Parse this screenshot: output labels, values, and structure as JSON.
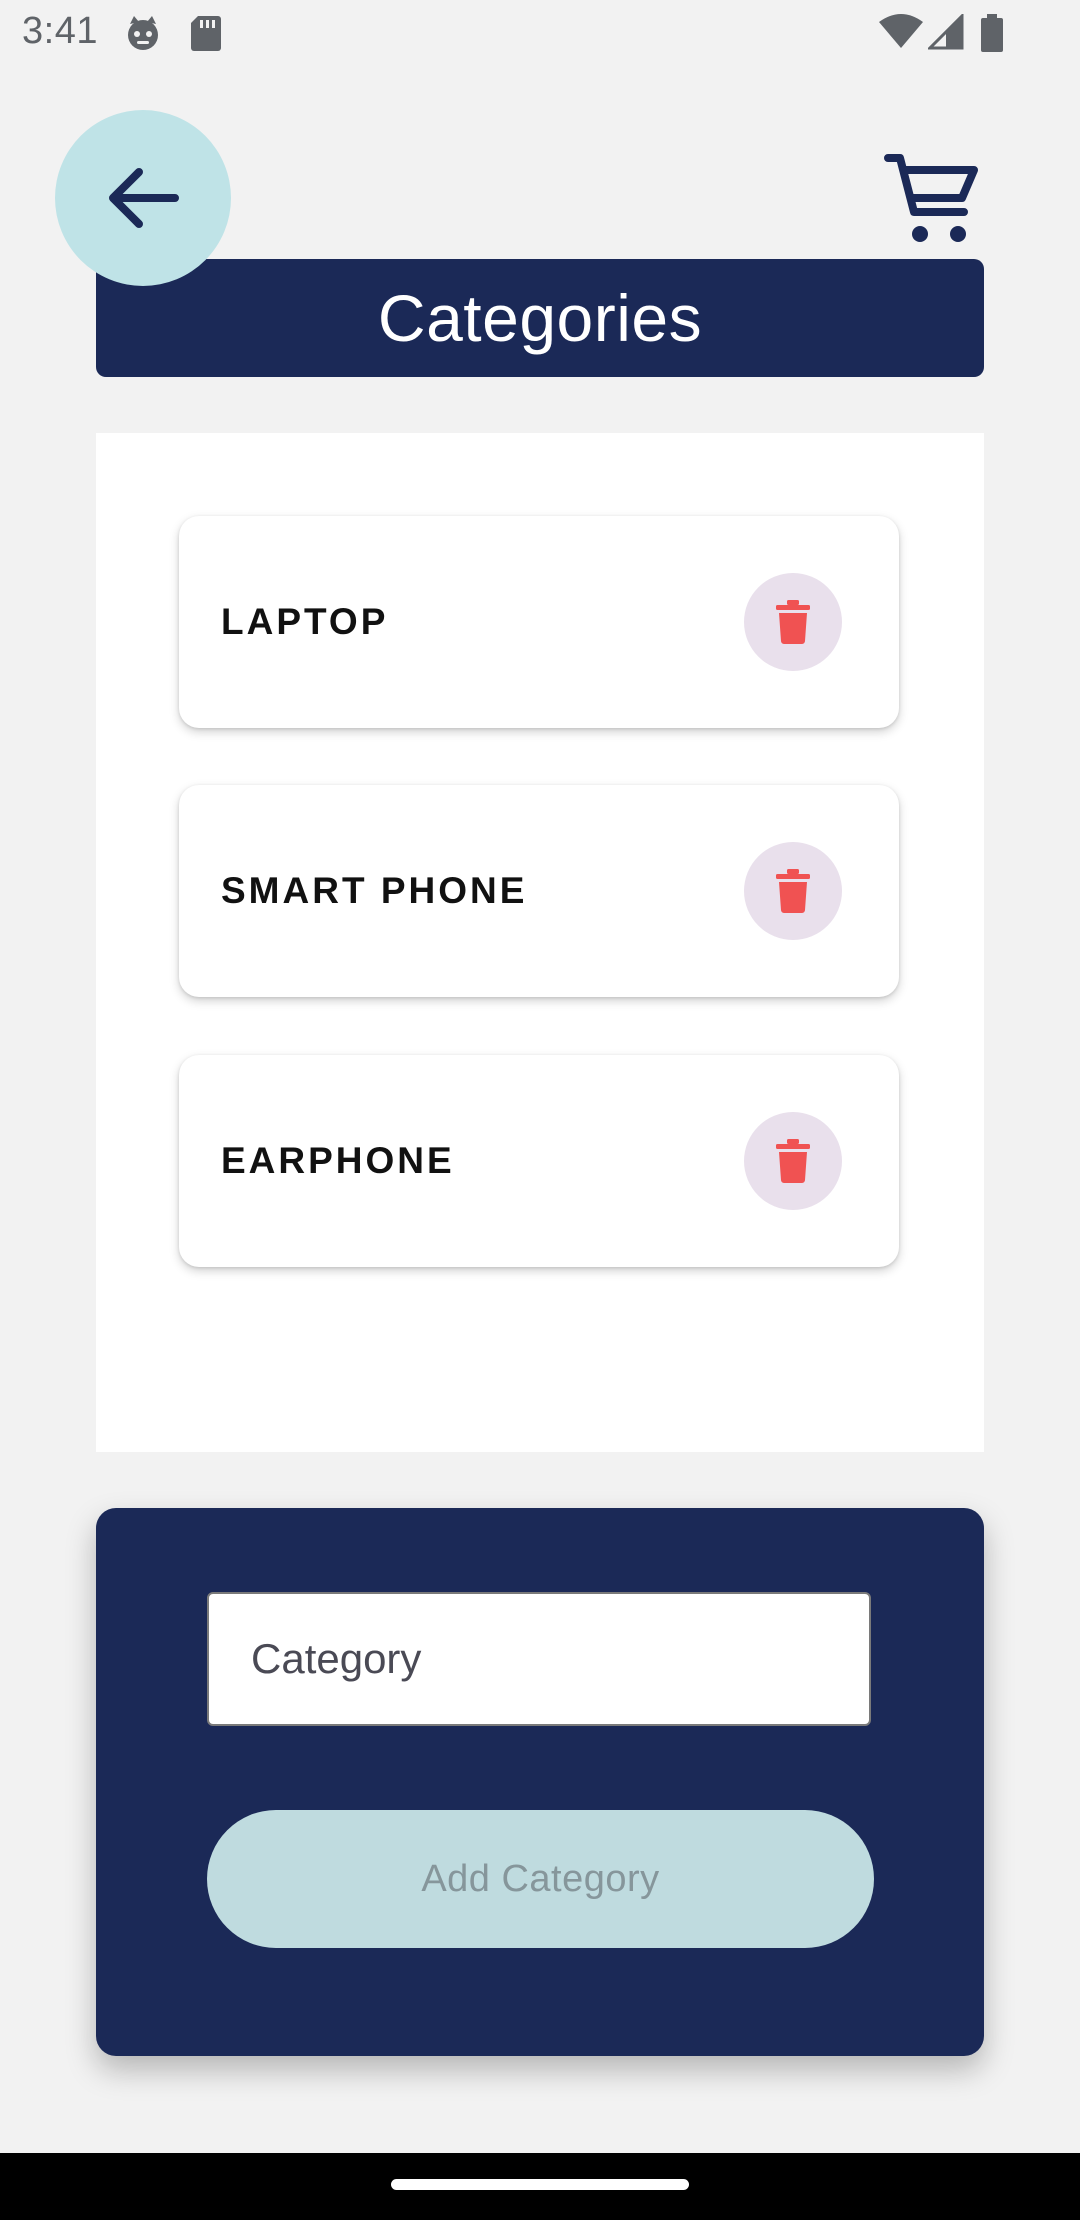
{
  "status_bar": {
    "time": "3:41"
  },
  "header": {
    "title": "Categories",
    "back_icon": "arrow-left-icon",
    "cart_icon": "shopping-cart-icon"
  },
  "categories": [
    {
      "label": "LAPTOP"
    },
    {
      "label": "SMART PHONE"
    },
    {
      "label": "EARPHONE"
    }
  ],
  "add_form": {
    "input_placeholder": "Category",
    "input_value": "",
    "button_label": "Add Category"
  },
  "colors": {
    "primary_navy": "#1b2957",
    "back_button_bg": "#bfe3e7",
    "delete_icon": "#f05252",
    "delete_button_bg": "#e9e0ec",
    "add_button_bg": "#bfdbdf",
    "page_bg": "#f2f2f2"
  }
}
